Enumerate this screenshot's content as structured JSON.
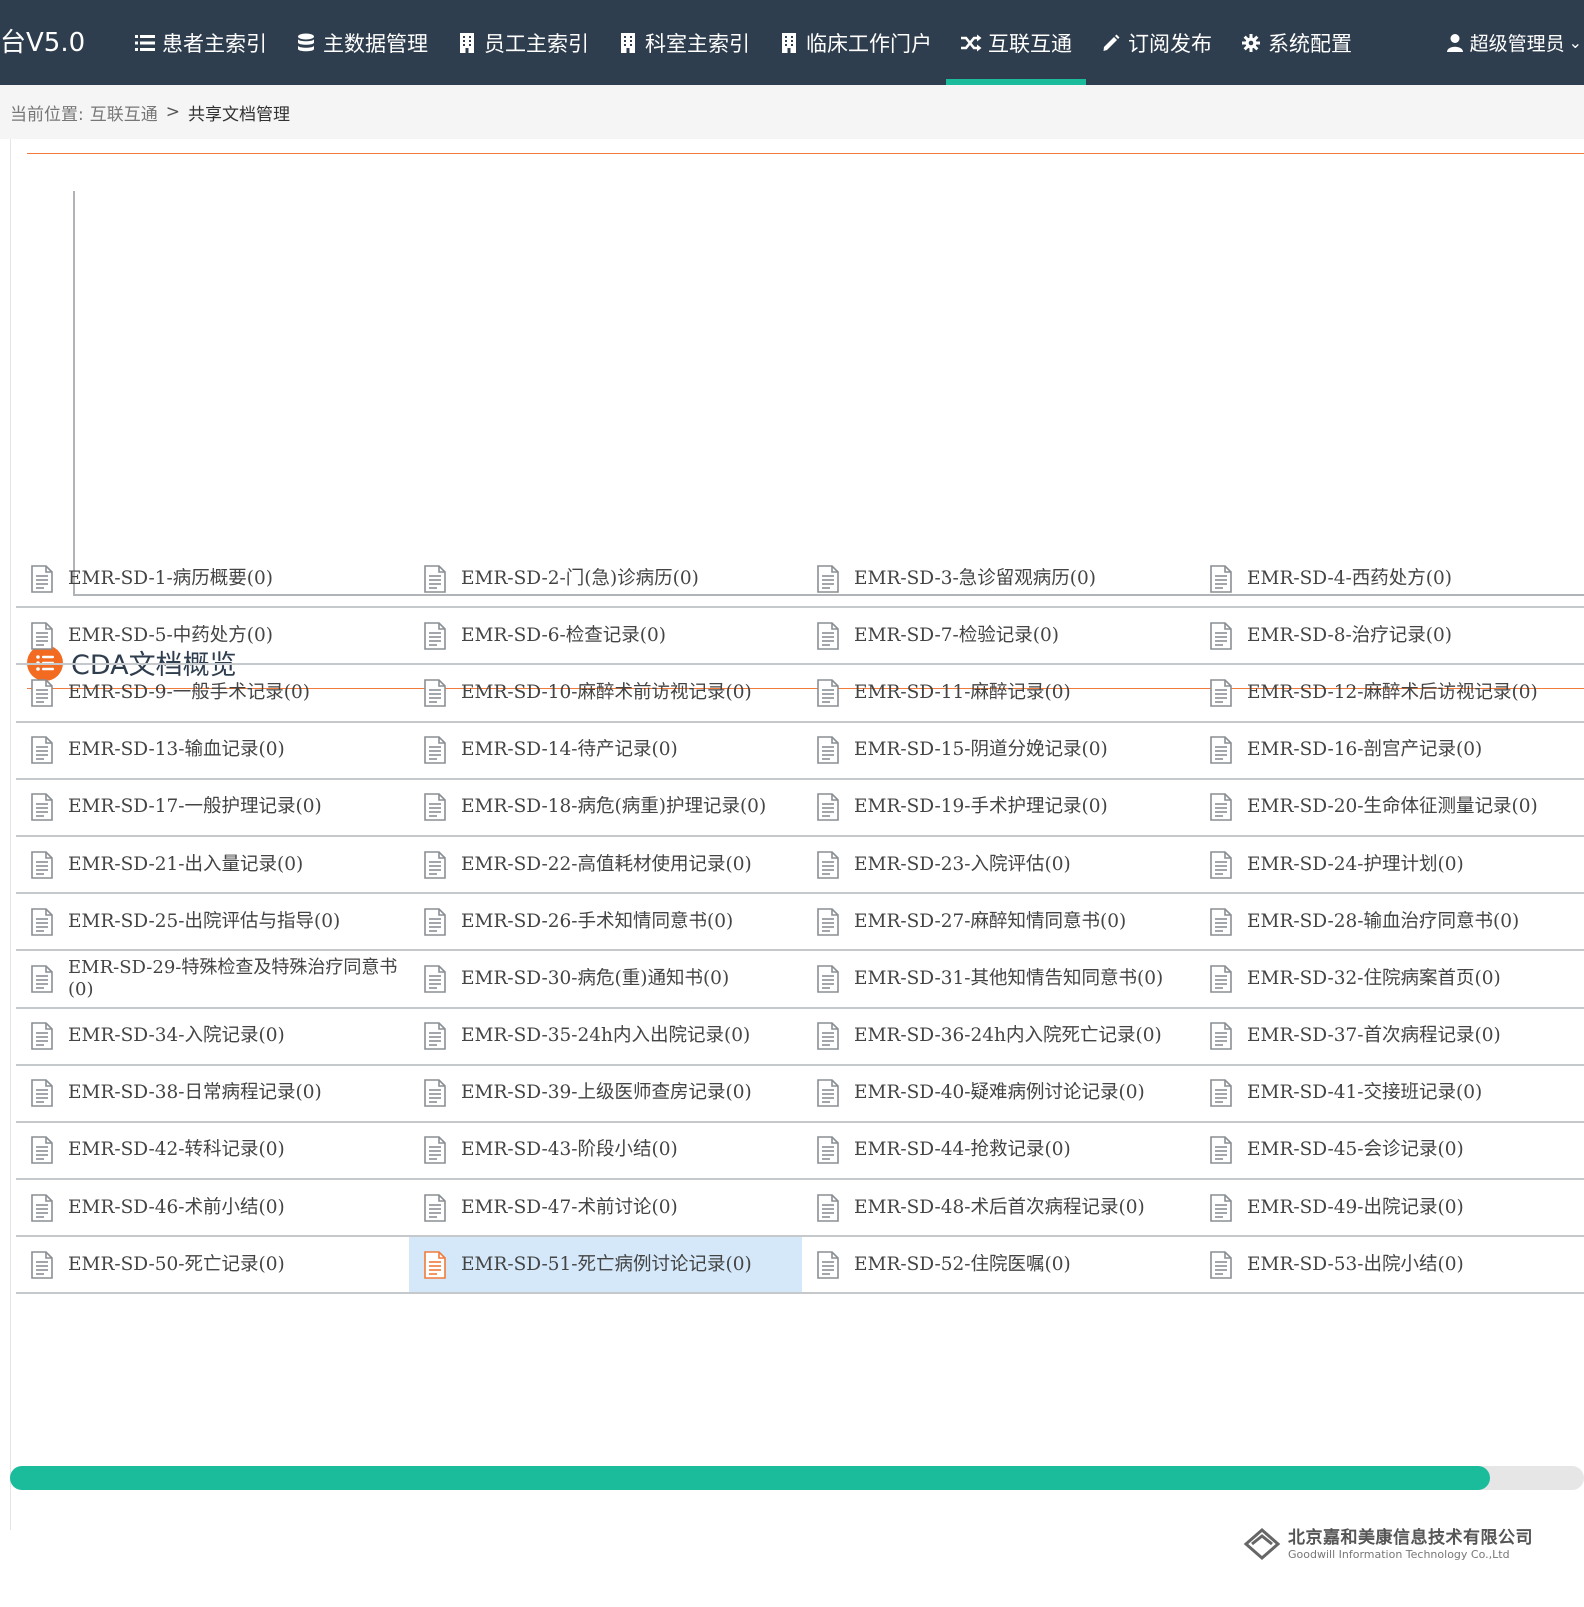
{
  "header": {
    "brand": "台V5.0",
    "nav": [
      {
        "label": "患者主索引",
        "icon": "list-icon"
      },
      {
        "label": "主数据管理",
        "icon": "database-icon"
      },
      {
        "label": "员工主索引",
        "icon": "building-icon"
      },
      {
        "label": "科室主索引",
        "icon": "building-icon"
      },
      {
        "label": "临床工作门户",
        "icon": "building-icon"
      },
      {
        "label": "互联互通",
        "icon": "random-icon"
      },
      {
        "label": "订阅发布",
        "icon": "pencil-icon"
      },
      {
        "label": "系统配置",
        "icon": "gear-icon"
      }
    ],
    "active_nav_index": 5,
    "user": {
      "label": "超级管理员",
      "icon": "user-icon",
      "caret": "⌄"
    }
  },
  "breadcrumb": {
    "prefix": "当前位置:",
    "parent": "互联互通",
    "separator": ">",
    "current": "共享文档管理"
  },
  "section": {
    "title": "CDA文档概览",
    "icon": "list-circle-icon"
  },
  "documents": [
    "EMR-SD-1-病历概要(0)",
    "EMR-SD-2-门(急)诊病历(0)",
    "EMR-SD-3-急诊留观病历(0)",
    "EMR-SD-4-西药处方(0)",
    "EMR-SD-5-中药处方(0)",
    "EMR-SD-6-检查记录(0)",
    "EMR-SD-7-检验记录(0)",
    "EMR-SD-8-治疗记录(0)",
    "EMR-SD-9-一般手术记录(0)",
    "EMR-SD-10-麻醉术前访视记录(0)",
    "EMR-SD-11-麻醉记录(0)",
    "EMR-SD-12-麻醉术后访视记录(0)",
    "EMR-SD-13-输血记录(0)",
    "EMR-SD-14-待产记录(0)",
    "EMR-SD-15-阴道分娩记录(0)",
    "EMR-SD-16-剖宫产记录(0)",
    "EMR-SD-17-一般护理记录(0)",
    "EMR-SD-18-病危(病重)护理记录(0)",
    "EMR-SD-19-手术护理记录(0)",
    "EMR-SD-20-生命体征测量记录(0)",
    "EMR-SD-21-出入量记录(0)",
    "EMR-SD-22-高值耗材使用记录(0)",
    "EMR-SD-23-入院评估(0)",
    "EMR-SD-24-护理计划(0)",
    "EMR-SD-25-出院评估与指导(0)",
    "EMR-SD-26-手术知情同意书(0)",
    "EMR-SD-27-麻醉知情同意书(0)",
    "EMR-SD-28-输血治疗同意书(0)",
    "EMR-SD-29-特殊检查及特殊治疗同意书(0)",
    "EMR-SD-30-病危(重)通知书(0)",
    "EMR-SD-31-其他知情告知同意书(0)",
    "EMR-SD-32-住院病案首页(0)",
    "EMR-SD-34-入院记录(0)",
    "EMR-SD-35-24h内入出院记录(0)",
    "EMR-SD-36-24h内入院死亡记录(0)",
    "EMR-SD-37-首次病程记录(0)",
    "EMR-SD-38-日常病程记录(0)",
    "EMR-SD-39-上级医师查房记录(0)",
    "EMR-SD-40-疑难病例讨论记录(0)",
    "EMR-SD-41-交接班记录(0)",
    "EMR-SD-42-转科记录(0)",
    "EMR-SD-43-阶段小结(0)",
    "EMR-SD-44-抢救记录(0)",
    "EMR-SD-45-会诊记录(0)",
    "EMR-SD-46-术前小结(0)",
    "EMR-SD-47-术前讨论(0)",
    "EMR-SD-48-术后首次病程记录(0)",
    "EMR-SD-49-出院记录(0)",
    "EMR-SD-50-死亡记录(0)",
    "EMR-SD-51-死亡病例讨论记录(0)",
    "EMR-SD-52-住院医嘱(0)",
    "EMR-SD-53-出院小结(0)"
  ],
  "selected_document_index": 49,
  "scrollbar": {
    "thumb_fraction": 0.94
  },
  "footer": {
    "company_cn": "北京嘉和美康信息技术有限公司",
    "company_en": "Goodwill Information Technology Co.,Ltd"
  },
  "colors": {
    "nav_bg": "#2f3e4e",
    "accent": "#1abc9c",
    "orange": "#f26b21",
    "selected_bg": "#d4e8fa"
  }
}
